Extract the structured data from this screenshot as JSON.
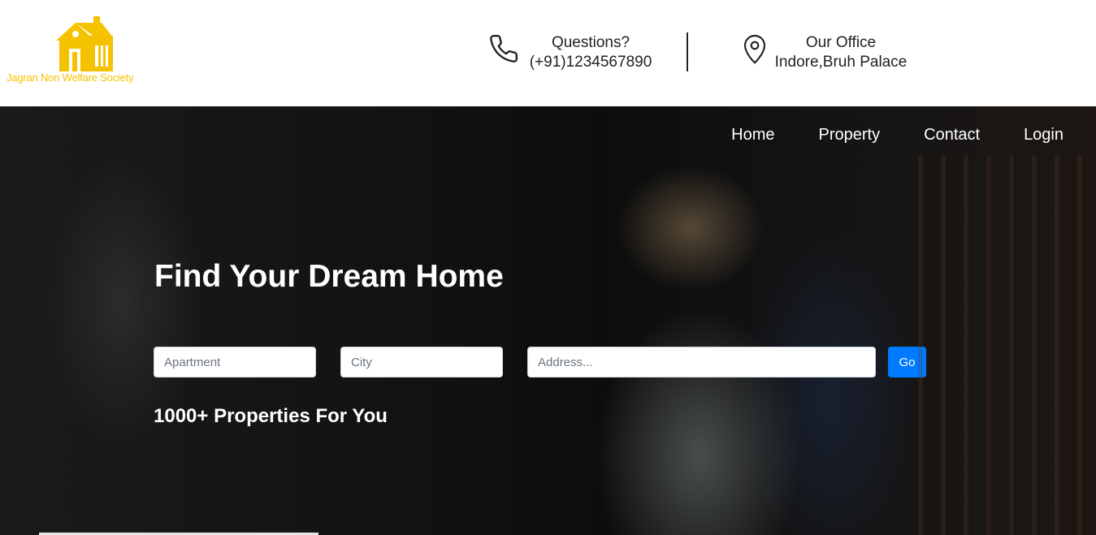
{
  "brand": {
    "name": "Jagran Non Welfare Society",
    "logo_icon": "house-icon",
    "accent_color": "#f5c200"
  },
  "header": {
    "phone": {
      "icon": "phone-icon",
      "label": "Questions?",
      "value": "(+91)1234567890"
    },
    "office": {
      "icon": "location-pin-icon",
      "label": "Our Office",
      "value": "Indore,Bruh Palace"
    }
  },
  "nav": {
    "items": [
      {
        "label": "Home"
      },
      {
        "label": "Property"
      },
      {
        "label": "Contact"
      },
      {
        "label": "Login"
      }
    ]
  },
  "hero": {
    "title": "Find Your Dream Home",
    "subtitle": "1000+ Properties For You",
    "search": {
      "type_placeholder": "Apartment",
      "city_placeholder": "City",
      "address_placeholder": "Address...",
      "go_label": "Go",
      "go_color": "#007bff"
    }
  }
}
